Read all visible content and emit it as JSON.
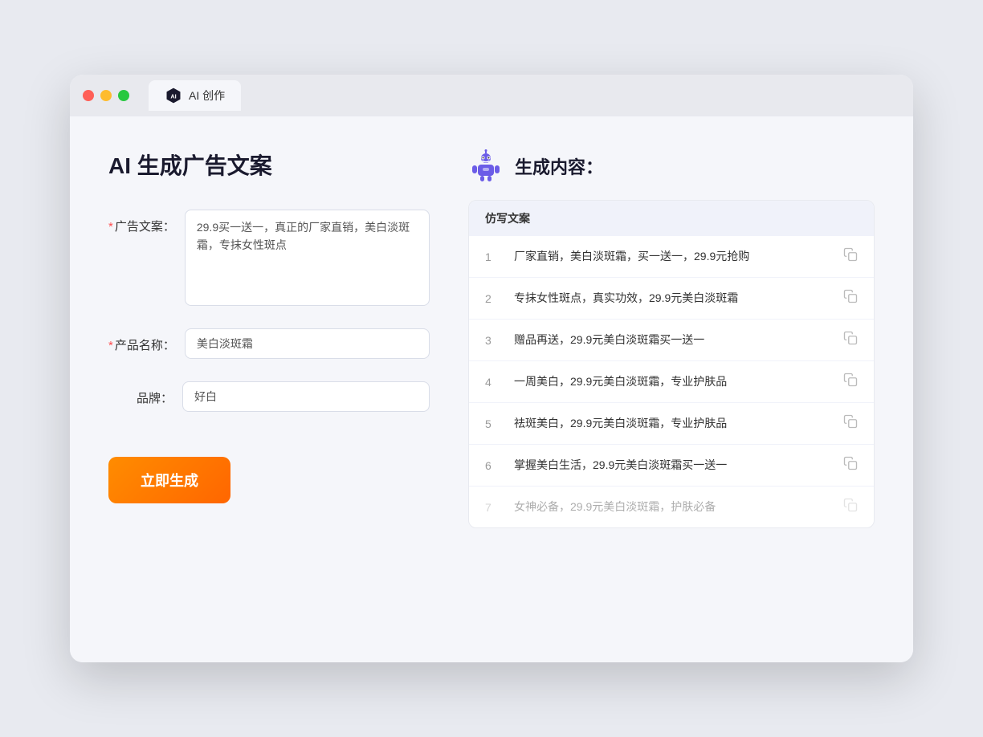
{
  "tab": {
    "label": "AI 创作"
  },
  "page": {
    "title": "AI 生成广告文案"
  },
  "form": {
    "ad_copy_label": "广告文案：",
    "ad_copy_required": "*",
    "ad_copy_value": "29.9买一送一，真正的厂家直销，美白淡斑霜，专抹女性斑点",
    "product_label": "产品名称：",
    "product_required": "*",
    "product_value": "美白淡斑霜",
    "brand_label": "品牌：",
    "brand_value": "好白",
    "generate_button": "立即生成"
  },
  "results": {
    "header": "生成内容：",
    "table_header": "仿写文案",
    "items": [
      {
        "num": "1",
        "text": "厂家直销，美白淡斑霜，买一送一，29.9元抢购"
      },
      {
        "num": "2",
        "text": "专抹女性斑点，真实功效，29.9元美白淡斑霜"
      },
      {
        "num": "3",
        "text": "赠品再送，29.9元美白淡斑霜买一送一"
      },
      {
        "num": "4",
        "text": "一周美白，29.9元美白淡斑霜，专业护肤品"
      },
      {
        "num": "5",
        "text": "祛斑美白，29.9元美白淡斑霜，专业护肤品"
      },
      {
        "num": "6",
        "text": "掌握美白生活，29.9元美白淡斑霜买一送一"
      },
      {
        "num": "7",
        "text": "女神必备，29.9元美白淡斑霜，护肤必备",
        "faded": true
      }
    ]
  }
}
